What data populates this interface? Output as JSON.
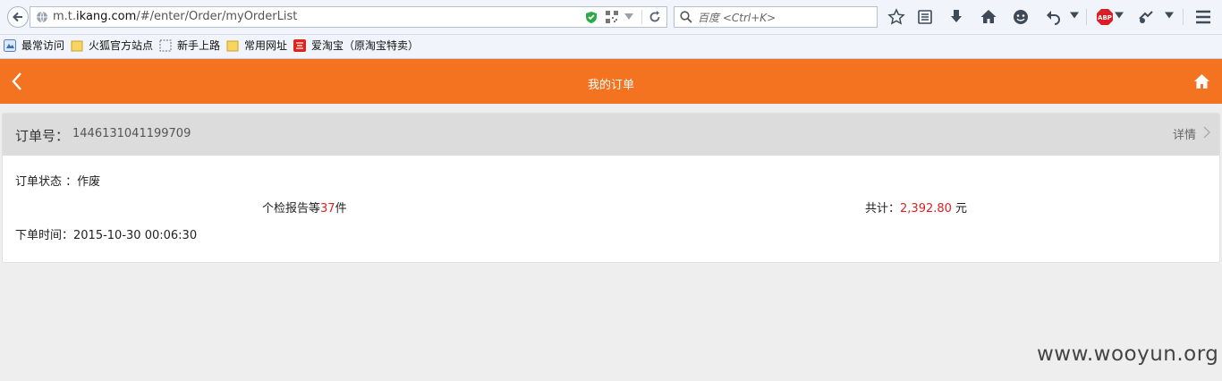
{
  "browser": {
    "url_prefix": "m.t.",
    "url_domain": "ikang.com",
    "url_path": "/#/enter/Order/myOrderList",
    "search_placeholder": "百度 <Ctrl+K>"
  },
  "bookmarks": [
    {
      "label": "最常访问",
      "icon": "bookmark-special-icon"
    },
    {
      "label": "火狐官方站点",
      "icon": "folder-icon"
    },
    {
      "label": "新手上路",
      "icon": "dashed-page-icon"
    },
    {
      "label": "常用网址",
      "icon": "folder-icon"
    },
    {
      "label": "爱淘宝（原淘宝特卖）",
      "icon": "taobao-icon"
    }
  ],
  "header": {
    "title": "我的订单"
  },
  "order": {
    "number_label": "订单号：",
    "number": "1446131041199709",
    "detail_label": "详情",
    "status_label": "订单状态 ：",
    "status": "作废",
    "items_prefix": "个检报告等",
    "items_count": "37",
    "items_suffix": "件",
    "total_label": "共计：",
    "total_amount": "2,392.80",
    "total_currency": " 元",
    "time_label": "下单时间：",
    "time": "2015-10-30 00:06:30"
  },
  "watermark": "www.wooyun.org",
  "colors": {
    "header_bg": "#f47321",
    "highlight_red": "#e02020"
  }
}
